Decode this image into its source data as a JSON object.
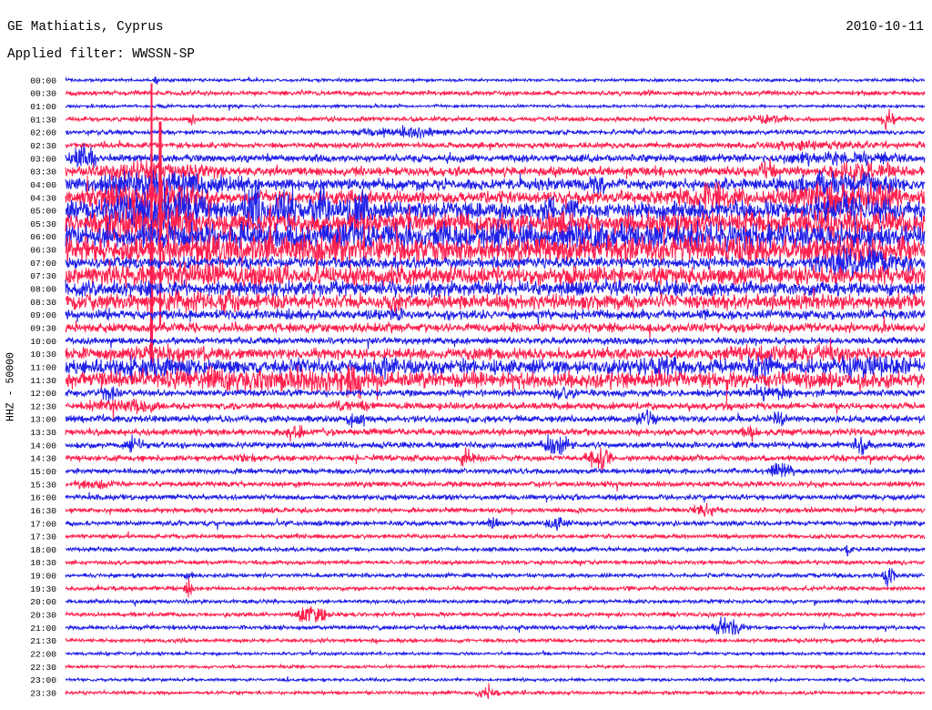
{
  "chart_data": {
    "type": "line",
    "title": "GE Mathiatis, Cyprus",
    "subtitle": "Applied filter: WWSSN-SP",
    "date": "2010-10-11",
    "ylabel": "HHZ - 50000",
    "xlabel": "",
    "xlim": [
      0,
      30
    ],
    "grid": false,
    "colors": {
      "blue": "#1f1fe8",
      "red": "#ff1f4d"
    },
    "traces": [
      {
        "label": "00:00",
        "color": "blue",
        "base": 0.8,
        "events": [
          [
            3.0,
            3.3,
            3
          ]
        ]
      },
      {
        "label": "00:30",
        "color": "red",
        "base": 1.2,
        "events": []
      },
      {
        "label": "01:00",
        "color": "blue",
        "base": 0.8,
        "events": []
      },
      {
        "label": "01:30",
        "color": "red",
        "base": 1.2,
        "events": [
          [
            4.2,
            4.7,
            3
          ],
          [
            23.6,
            25.4,
            3
          ],
          [
            28.4,
            29.0,
            6
          ]
        ]
      },
      {
        "label": "02:00",
        "color": "blue",
        "base": 1.2,
        "events": [
          [
            9.4,
            14.0,
            3
          ],
          [
            19.6,
            20.0,
            2
          ]
        ]
      },
      {
        "label": "02:30",
        "color": "red",
        "base": 1.5,
        "events": [
          [
            22.0,
            30.0,
            2.5
          ]
        ]
      },
      {
        "label": "03:00",
        "color": "blue",
        "base": 2.0,
        "events": [
          [
            0,
            1.2,
            7
          ],
          [
            13,
            14,
            3
          ],
          [
            24,
            30,
            4
          ]
        ]
      },
      {
        "label": "03:30",
        "color": "red",
        "base": 2.5,
        "events": [
          [
            0,
            6,
            6
          ],
          [
            24,
            25,
            6
          ],
          [
            26,
            30,
            5
          ]
        ]
      },
      {
        "label": "04:00",
        "color": "blue",
        "base": 3.0,
        "events": [
          [
            0,
            7,
            8
          ],
          [
            18,
            19,
            6
          ],
          [
            24,
            30,
            7
          ]
        ]
      },
      {
        "label": "04:30",
        "color": "red",
        "base": 3.5,
        "events": [
          [
            0,
            6,
            9
          ],
          [
            20.5,
            24.2,
            8
          ],
          [
            24.2,
            30,
            9
          ]
        ]
      },
      {
        "label": "05:00",
        "color": "blue",
        "base": 5.0,
        "events": [
          [
            0,
            6,
            11
          ],
          [
            6.1,
            7.2,
            14
          ],
          [
            7.2,
            8.2,
            14
          ],
          [
            8.4,
            9.4,
            14
          ],
          [
            9.6,
            10.8,
            15
          ],
          [
            16.6,
            17.2,
            9
          ],
          [
            17.4,
            18,
            8
          ],
          [
            25,
            30,
            8
          ]
        ]
      },
      {
        "label": "05:30",
        "color": "red",
        "base": 6.0,
        "events": [
          [
            0,
            6.2,
            12
          ],
          [
            17,
            18,
            8
          ],
          [
            24,
            30,
            8
          ]
        ],
        "spikes": [
          [
            3.0,
            110
          ],
          [
            3.3,
            80
          ]
        ]
      },
      {
        "label": "06:00",
        "color": "blue",
        "base": 7.0,
        "events": [
          [
            0,
            14,
            7
          ],
          [
            14,
            16,
            10
          ],
          [
            16,
            30,
            8
          ]
        ]
      },
      {
        "label": "06:30",
        "color": "red",
        "base": 7.0,
        "events": [
          [
            0,
            14.1,
            8
          ],
          [
            28,
            30,
            5
          ]
        ]
      },
      {
        "label": "07:00",
        "color": "blue",
        "base": 3.0,
        "events": [
          [
            25.5,
            30,
            8
          ]
        ]
      },
      {
        "label": "07:30",
        "color": "red",
        "base": 5.0,
        "events": [
          [
            0,
            10,
            7
          ]
        ]
      },
      {
        "label": "08:00",
        "color": "blue",
        "base": 4.0,
        "events": []
      },
      {
        "label": "08:30",
        "color": "red",
        "base": 4.0,
        "events": [
          [
            0,
            8.2,
            6
          ],
          [
            11.1,
            12,
            6
          ]
        ]
      },
      {
        "label": "09:00",
        "color": "blue",
        "base": 2.5,
        "events": [
          [
            7.5,
            8.5,
            4
          ],
          [
            11.1,
            12,
            4
          ]
        ]
      },
      {
        "label": "09:30",
        "color": "red",
        "base": 2.5,
        "events": []
      },
      {
        "label": "10:00",
        "color": "blue",
        "base": 1.8,
        "events": []
      },
      {
        "label": "10:30",
        "color": "red",
        "base": 3.0,
        "events": [
          [
            0,
            7,
            5
          ],
          [
            20.5,
            30,
            5
          ]
        ]
      },
      {
        "label": "11:00",
        "color": "blue",
        "base": 4.0,
        "events": [
          [
            0,
            6,
            6
          ],
          [
            10,
            12,
            6
          ],
          [
            20,
            22,
            7
          ],
          [
            23.5,
            25,
            7
          ],
          [
            26,
            30,
            7
          ]
        ]
      },
      {
        "label": "11:30",
        "color": "red",
        "base": 4.5,
        "events": [
          [
            0,
            12.6,
            7
          ],
          [
            9.6,
            10.6,
            11
          ]
        ]
      },
      {
        "label": "12:00",
        "color": "blue",
        "base": 1.8,
        "events": [
          [
            1,
            2,
            4
          ],
          [
            16.8,
            18,
            4
          ],
          [
            23.6,
            25.6,
            4
          ]
        ]
      },
      {
        "label": "12:30",
        "color": "red",
        "base": 1.8,
        "events": [
          [
            0,
            4,
            4
          ],
          [
            9,
            11,
            4
          ]
        ]
      },
      {
        "label": "13:00",
        "color": "blue",
        "base": 1.8,
        "events": [
          [
            9.5,
            10.6,
            5
          ],
          [
            19.8,
            20.8,
            5
          ],
          [
            24.4,
            25.4,
            4
          ]
        ]
      },
      {
        "label": "13:30",
        "color": "red",
        "base": 1.8,
        "events": [
          [
            7.6,
            8.4,
            5
          ],
          [
            23.5,
            24.2,
            5
          ]
        ]
      },
      {
        "label": "14:00",
        "color": "blue",
        "base": 1.6,
        "events": [
          [
            1.9,
            2.9,
            5
          ],
          [
            16.5,
            17.8,
            6
          ],
          [
            27.4,
            28.2,
            5
          ]
        ]
      },
      {
        "label": "14:30",
        "color": "red",
        "base": 1.6,
        "events": [
          [
            5.8,
            6.8,
            3
          ],
          [
            13.6,
            14.6,
            5
          ],
          [
            18,
            19.2,
            6
          ]
        ]
      },
      {
        "label": "15:00",
        "color": "blue",
        "base": 1.4,
        "events": [
          [
            24.4,
            25.6,
            5
          ]
        ]
      },
      {
        "label": "15:30",
        "color": "red",
        "base": 1.4,
        "events": [
          [
            0,
            2,
            3
          ]
        ]
      },
      {
        "label": "16:00",
        "color": "blue",
        "base": 1.4,
        "events": []
      },
      {
        "label": "16:30",
        "color": "red",
        "base": 1.3,
        "events": [
          [
            21.7,
            22.9,
            4
          ]
        ]
      },
      {
        "label": "17:00",
        "color": "blue",
        "base": 1.3,
        "events": [
          [
            14.6,
            15.2,
            4
          ],
          [
            16.6,
            17.8,
            4
          ]
        ]
      },
      {
        "label": "17:30",
        "color": "red",
        "base": 1.1,
        "events": []
      },
      {
        "label": "18:00",
        "color": "blue",
        "base": 1.1,
        "events": [
          [
            27.1,
            27.6,
            3
          ]
        ]
      },
      {
        "label": "18:30",
        "color": "red",
        "base": 1.1,
        "events": []
      },
      {
        "label": "19:00",
        "color": "blue",
        "base": 1.1,
        "events": [
          [
            4.1,
            4.5,
            4
          ],
          [
            28.5,
            29.0,
            7
          ]
        ]
      },
      {
        "label": "19:30",
        "color": "red",
        "base": 1.1,
        "events": [
          [
            4.1,
            4.5,
            6
          ]
        ]
      },
      {
        "label": "20:00",
        "color": "blue",
        "base": 1.0,
        "events": []
      },
      {
        "label": "20:30",
        "color": "red",
        "base": 1.1,
        "events": [
          [
            7.9,
            9.3,
            5
          ]
        ]
      },
      {
        "label": "21:00",
        "color": "blue",
        "base": 1.1,
        "events": [
          [
            22.5,
            23.8,
            5
          ]
        ]
      },
      {
        "label": "21:30",
        "color": "red",
        "base": 1.0,
        "events": []
      },
      {
        "label": "22:00",
        "color": "blue",
        "base": 0.8,
        "events": []
      },
      {
        "label": "22:30",
        "color": "red",
        "base": 0.8,
        "events": []
      },
      {
        "label": "23:00",
        "color": "blue",
        "base": 0.8,
        "events": []
      },
      {
        "label": "23:30",
        "color": "red",
        "base": 0.9,
        "events": [
          [
            14.2,
            15.2,
            4
          ]
        ]
      }
    ]
  }
}
